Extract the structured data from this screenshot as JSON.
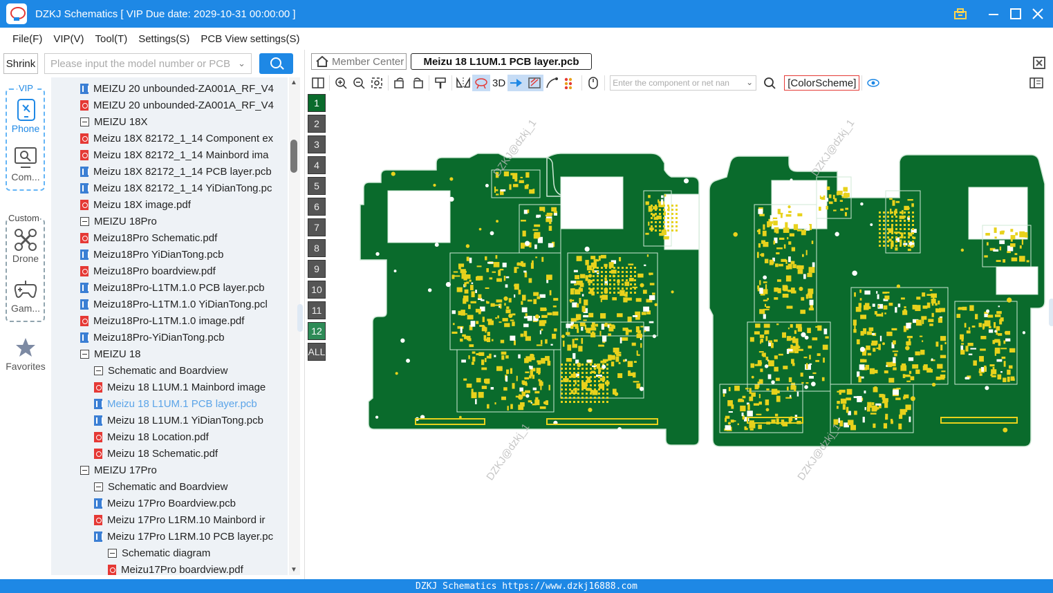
{
  "window": {
    "title": "DZKJ Schematics [ VIP Due date: 2029-10-31 00:00:00 ]"
  },
  "menu": [
    "File(F)",
    "VIP(V)",
    "Tool(T)",
    "Settings(S)",
    "PCB View settings(S)"
  ],
  "left_panel": {
    "shrink_label": "Shrink",
    "search_placeholder": "Please input the model number or PCB"
  },
  "side_nav": {
    "vip_label": "VIP",
    "phone_label": "Phone",
    "computer_label": "Com...",
    "custom_label": "Custom",
    "drone_label": "Drone",
    "game_label": "Gam...",
    "favorites_label": "Favorites"
  },
  "tree": [
    {
      "label": "MEIZU 20 unbounded-ZA001A_RF_V4",
      "type": "pcb",
      "level": 1
    },
    {
      "label": "MEIZU 20 unbounded-ZA001A_RF_V4",
      "type": "pdf",
      "level": 1
    },
    {
      "label": "MEIZU 18X",
      "type": "folder",
      "level": 0
    },
    {
      "label": "Meizu 18X 82172_1_14 Component ex",
      "type": "pdf",
      "level": 1
    },
    {
      "label": "Meizu 18X 82172_1_14 Mainbord ima",
      "type": "pdf",
      "level": 1
    },
    {
      "label": "Meizu 18X 82172_1_14 PCB layer.pcb",
      "type": "pcb",
      "level": 1
    },
    {
      "label": "Meizu 18X 82172_1_14 YiDianTong.pc",
      "type": "pcb",
      "level": 1
    },
    {
      "label": "Meizu 18X image.pdf",
      "type": "pdf",
      "level": 1
    },
    {
      "label": "MEIZU 18Pro",
      "type": "folder",
      "level": 0
    },
    {
      "label": "Meizu18Pro Schematic.pdf",
      "type": "pdf",
      "level": 1
    },
    {
      "label": "Meizu18Pro YiDianTong.pcb",
      "type": "pcb",
      "level": 1
    },
    {
      "label": "Meizu18Pro boardview.pdf",
      "type": "pdf",
      "level": 1
    },
    {
      "label": "Meizu18Pro-L1TM.1.0 PCB layer.pcb",
      "type": "pcb",
      "level": 1
    },
    {
      "label": "Meizu18Pro-L1TM.1.0 YiDianTong.pcl",
      "type": "pcb",
      "level": 1
    },
    {
      "label": "Meizu18Pro-L1TM.1.0 image.pdf",
      "type": "pdf",
      "level": 1
    },
    {
      "label": "Meizu18Pro-YiDianTong.pcb",
      "type": "pcb",
      "level": 1
    },
    {
      "label": "MEIZU 18",
      "type": "folder",
      "level": 0
    },
    {
      "label": "Schematic and Boardview",
      "type": "folder",
      "level": 1
    },
    {
      "label": "Meizu 18 L1UM.1 Mainbord image",
      "type": "pdf",
      "level": 2
    },
    {
      "label": "Meizu 18 L1UM.1 PCB layer.pcb",
      "type": "pcb",
      "level": 2,
      "selected": true
    },
    {
      "label": "Meizu 18 L1UM.1 YiDianTong.pcb",
      "type": "pcb",
      "level": 2
    },
    {
      "label": "Meizu 18 Location.pdf",
      "type": "pdf",
      "level": 2
    },
    {
      "label": "Meizu 18 Schematic.pdf",
      "type": "pdf",
      "level": 2
    },
    {
      "label": "MEIZU 17Pro",
      "type": "folder",
      "level": 0
    },
    {
      "label": "Schematic and Boardview",
      "type": "folder",
      "level": 1
    },
    {
      "label": "Meizu 17Pro Boardview.pcb",
      "type": "pcb",
      "level": 2
    },
    {
      "label": "Meizu 17Pro L1RM.10 Mainbord ir",
      "type": "pdf",
      "level": 2
    },
    {
      "label": "Meizu 17Pro L1RM.10 PCB layer.pc",
      "type": "pcb",
      "level": 2
    },
    {
      "label": "Schematic diagram",
      "type": "folder",
      "level": 2
    },
    {
      "label": "Meizu17Pro boardview.pdf",
      "type": "pdf",
      "level": 3
    }
  ],
  "tabs": {
    "member_center": "Member Center",
    "active_tab": "Meizu 18 L1UM.1 PCB layer.pcb"
  },
  "toolbar": {
    "three_d_label": "3D",
    "component_search_placeholder": "Enter the component or net nan",
    "color_scheme_label": "[ColorScheme]"
  },
  "layers": [
    "1",
    "2",
    "3",
    "4",
    "5",
    "6",
    "7",
    "8",
    "9",
    "10",
    "11",
    "12",
    "ALL"
  ],
  "watermark": "DZKJ@dzkj_1",
  "statusbar": "DZKJ Schematics  https://www.dzkj16888.com",
  "colors": {
    "accent": "#1e88e5",
    "pcb_board": "#0a6b2c",
    "pcb_pad": "#e8d21c"
  }
}
